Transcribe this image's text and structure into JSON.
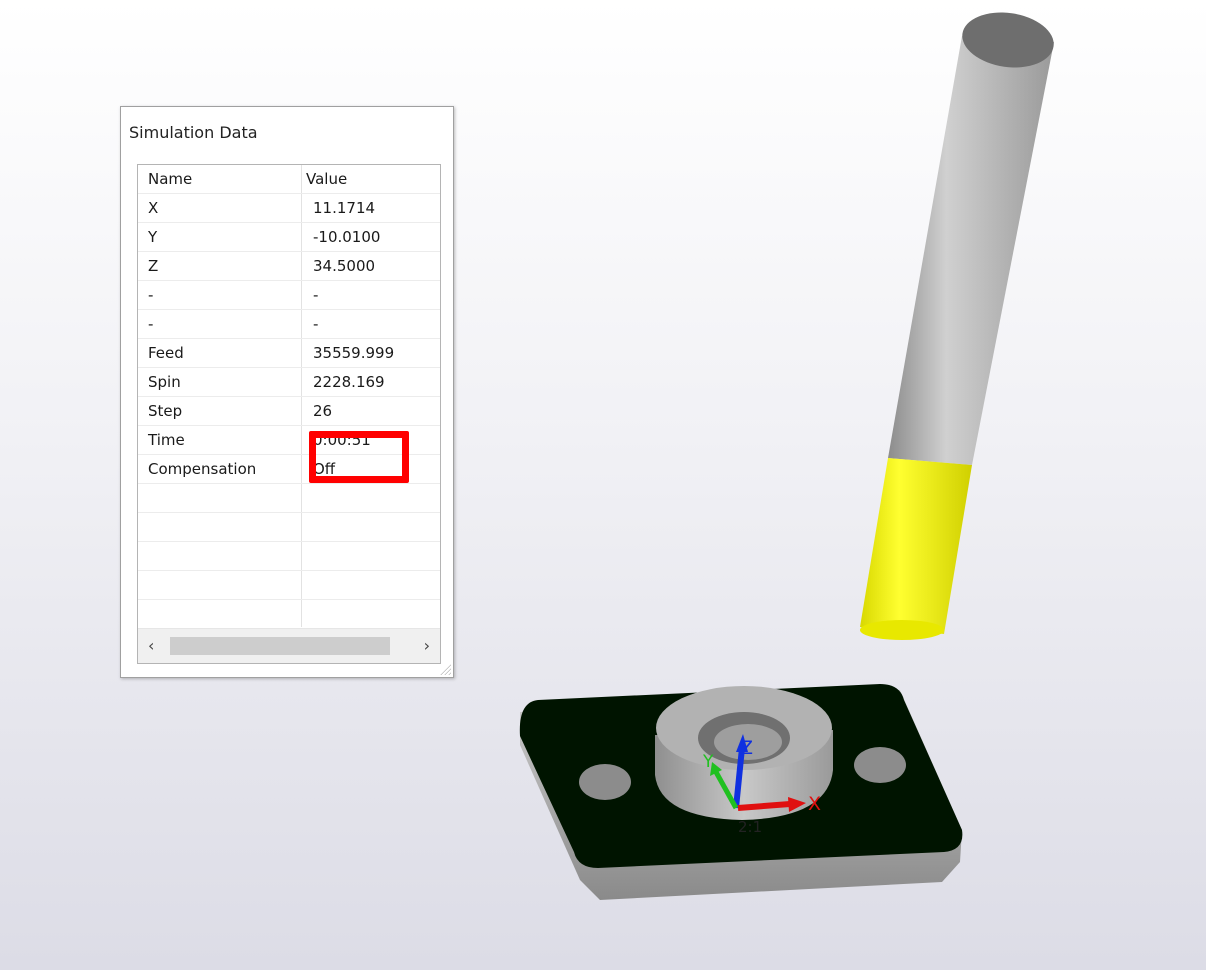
{
  "panel": {
    "title": "Simulation Data",
    "columns": {
      "name": "Name",
      "value": "Value"
    },
    "rows": [
      {
        "name": "X",
        "value": "11.1714"
      },
      {
        "name": "Y",
        "value": "-10.0100"
      },
      {
        "name": "Z",
        "value": "34.5000"
      },
      {
        "name": "-",
        "value": "-"
      },
      {
        "name": "-",
        "value": "-"
      },
      {
        "name": "Feed",
        "value": "35559.999"
      },
      {
        "name": "Spin",
        "value": "2228.169"
      },
      {
        "name": "Step",
        "value": "26"
      },
      {
        "name": "Time",
        "value": "0:00:51"
      },
      {
        "name": "Compensation",
        "value": "Off"
      }
    ],
    "scroll_left_icon": "chevron-left-icon",
    "scroll_right_icon": "chevron-right-icon"
  },
  "viewport": {
    "axes": {
      "x": "X",
      "y": "Y",
      "z": "Z"
    },
    "origin_label": "2:1",
    "colors": {
      "tool_shank": "#bdbdbd",
      "tool_flute": "#f0f000",
      "fixture_top": "#001400",
      "part": "#a8a8a8",
      "axis_x": "#e01010",
      "axis_y": "#20c020",
      "axis_z": "#1030e0",
      "highlight": "#ff0000"
    }
  }
}
